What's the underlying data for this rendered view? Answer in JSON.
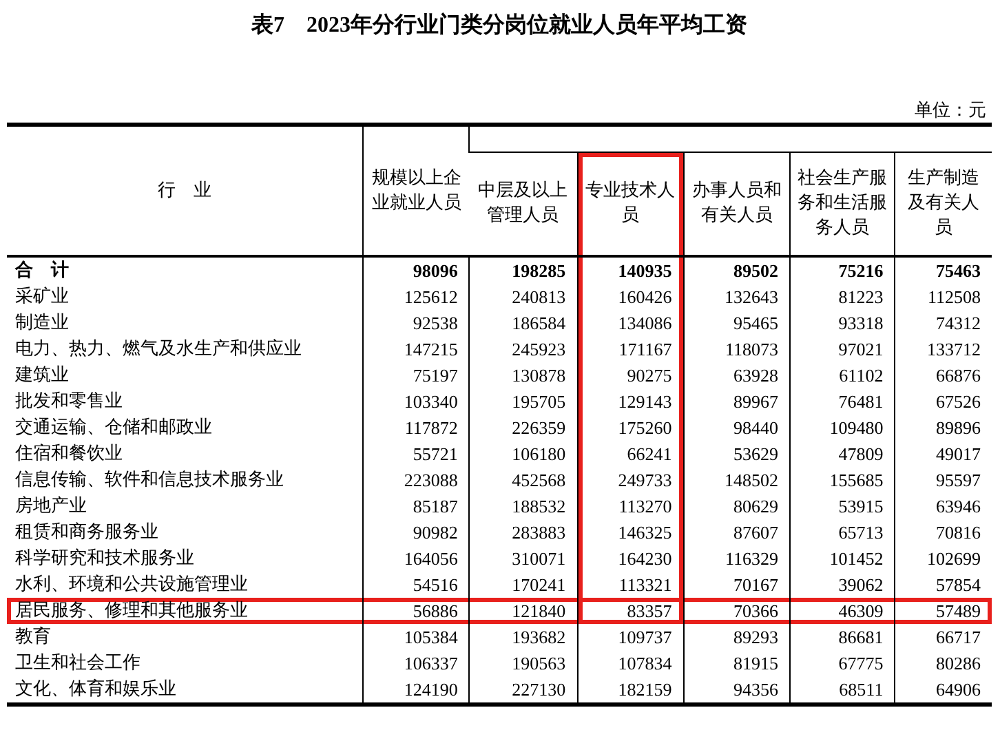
{
  "title": "表7　2023年分行业门类分岗位就业人员年平均工资",
  "unit": "单位：元",
  "columns": [
    {
      "label": "行　业",
      "highlighted": false
    },
    {
      "label": "规模以上企业就业人员",
      "highlighted": false
    },
    {
      "label": "中层及以上管理人员",
      "highlighted": false
    },
    {
      "label": "专业技术人员",
      "highlighted": true
    },
    {
      "label": "办事人员和有关人员",
      "highlighted": false
    },
    {
      "label": "社会生产服务和生活服务人员",
      "highlighted": false
    },
    {
      "label": "生产制造及有关人员",
      "highlighted": false
    }
  ],
  "rows": [
    {
      "kind": "total",
      "industry": "合　计",
      "values": [
        "98096",
        "198285",
        "140935",
        "89502",
        "75216",
        "75463"
      ],
      "highlighted": false
    },
    {
      "kind": "item",
      "industry": "采矿业",
      "values": [
        "125612",
        "240813",
        "160426",
        "132643",
        "81223",
        "112508"
      ],
      "highlighted": false
    },
    {
      "kind": "item",
      "industry": "制造业",
      "values": [
        "92538",
        "186584",
        "134086",
        "95465",
        "93318",
        "74312"
      ],
      "highlighted": false
    },
    {
      "kind": "item",
      "industry": "电力、热力、燃气及水生产和供应业",
      "values": [
        "147215",
        "245923",
        "171167",
        "118073",
        "97021",
        "133712"
      ],
      "highlighted": false
    },
    {
      "kind": "item",
      "industry": "建筑业",
      "values": [
        "75197",
        "130878",
        "90275",
        "63928",
        "61102",
        "66876"
      ],
      "highlighted": false
    },
    {
      "kind": "item",
      "industry": "批发和零售业",
      "values": [
        "103340",
        "195705",
        "129143",
        "89967",
        "76481",
        "67526"
      ],
      "highlighted": false
    },
    {
      "kind": "item",
      "industry": "交通运输、仓储和邮政业",
      "values": [
        "117872",
        "226359",
        "175260",
        "98440",
        "109480",
        "89896"
      ],
      "highlighted": false
    },
    {
      "kind": "item",
      "industry": "住宿和餐饮业",
      "values": [
        "55721",
        "106180",
        "66241",
        "53629",
        "47809",
        "49017"
      ],
      "highlighted": false
    },
    {
      "kind": "item",
      "industry": "信息传输、软件和信息技术服务业",
      "values": [
        "223088",
        "452568",
        "249733",
        "148502",
        "155685",
        "95597"
      ],
      "highlighted": false
    },
    {
      "kind": "item",
      "industry": "房地产业",
      "values": [
        "85187",
        "188532",
        "113270",
        "80629",
        "53915",
        "63946"
      ],
      "highlighted": false
    },
    {
      "kind": "item",
      "industry": "租赁和商务服务业",
      "values": [
        "90982",
        "283883",
        "146325",
        "87607",
        "65713",
        "70816"
      ],
      "highlighted": false
    },
    {
      "kind": "item",
      "industry": "科学研究和技术服务业",
      "values": [
        "164056",
        "310071",
        "164230",
        "116329",
        "101452",
        "102699"
      ],
      "highlighted": false
    },
    {
      "kind": "item",
      "industry": "水利、环境和公共设施管理业",
      "values": [
        "54516",
        "170241",
        "113321",
        "70167",
        "39062",
        "57854"
      ],
      "highlighted": false
    },
    {
      "kind": "item",
      "industry": "居民服务、修理和其他服务业",
      "values": [
        "56886",
        "121840",
        "83357",
        "70366",
        "46309",
        "57489"
      ],
      "highlighted": true
    },
    {
      "kind": "item",
      "industry": "教育",
      "values": [
        "105384",
        "193682",
        "109737",
        "89293",
        "86681",
        "66717"
      ],
      "highlighted": false
    },
    {
      "kind": "item",
      "industry": "卫生和社会工作",
      "values": [
        "106337",
        "190563",
        "107834",
        "81915",
        "67775",
        "80286"
      ],
      "highlighted": false
    },
    {
      "kind": "item",
      "industry": "文化、体育和娱乐业",
      "values": [
        "124190",
        "227130",
        "182159",
        "94356",
        "68511",
        "64906"
      ],
      "highlighted": false
    }
  ]
}
